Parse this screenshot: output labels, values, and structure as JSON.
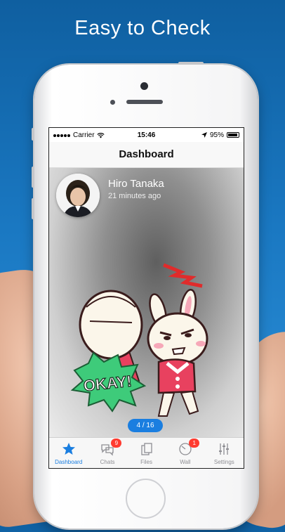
{
  "headline": "Easy to Check",
  "status_bar": {
    "carrier": "Carrier",
    "time": "15:46",
    "battery": "95%"
  },
  "nav": {
    "title": "Dashboard"
  },
  "post": {
    "user_name": "Hiro Tanaka",
    "time_ago": "21 minutes ago",
    "sticker_text": "OKAY!"
  },
  "pager": {
    "label": "4 / 16"
  },
  "tabs": [
    {
      "label": "Dashboard",
      "icon": "star-icon",
      "badge": ""
    },
    {
      "label": "Chats",
      "icon": "chat-bubbles-icon",
      "badge": "9"
    },
    {
      "label": "Files",
      "icon": "files-icon",
      "badge": ""
    },
    {
      "label": "Wall",
      "icon": "clock-icon",
      "badge": "1"
    },
    {
      "label": "Settings",
      "icon": "sliders-icon",
      "badge": ""
    }
  ],
  "colors": {
    "accent": "#1a7ee0",
    "badge": "#ff3b30",
    "background_top": "#0f5fa0",
    "background_bottom": "#2f95dd"
  }
}
